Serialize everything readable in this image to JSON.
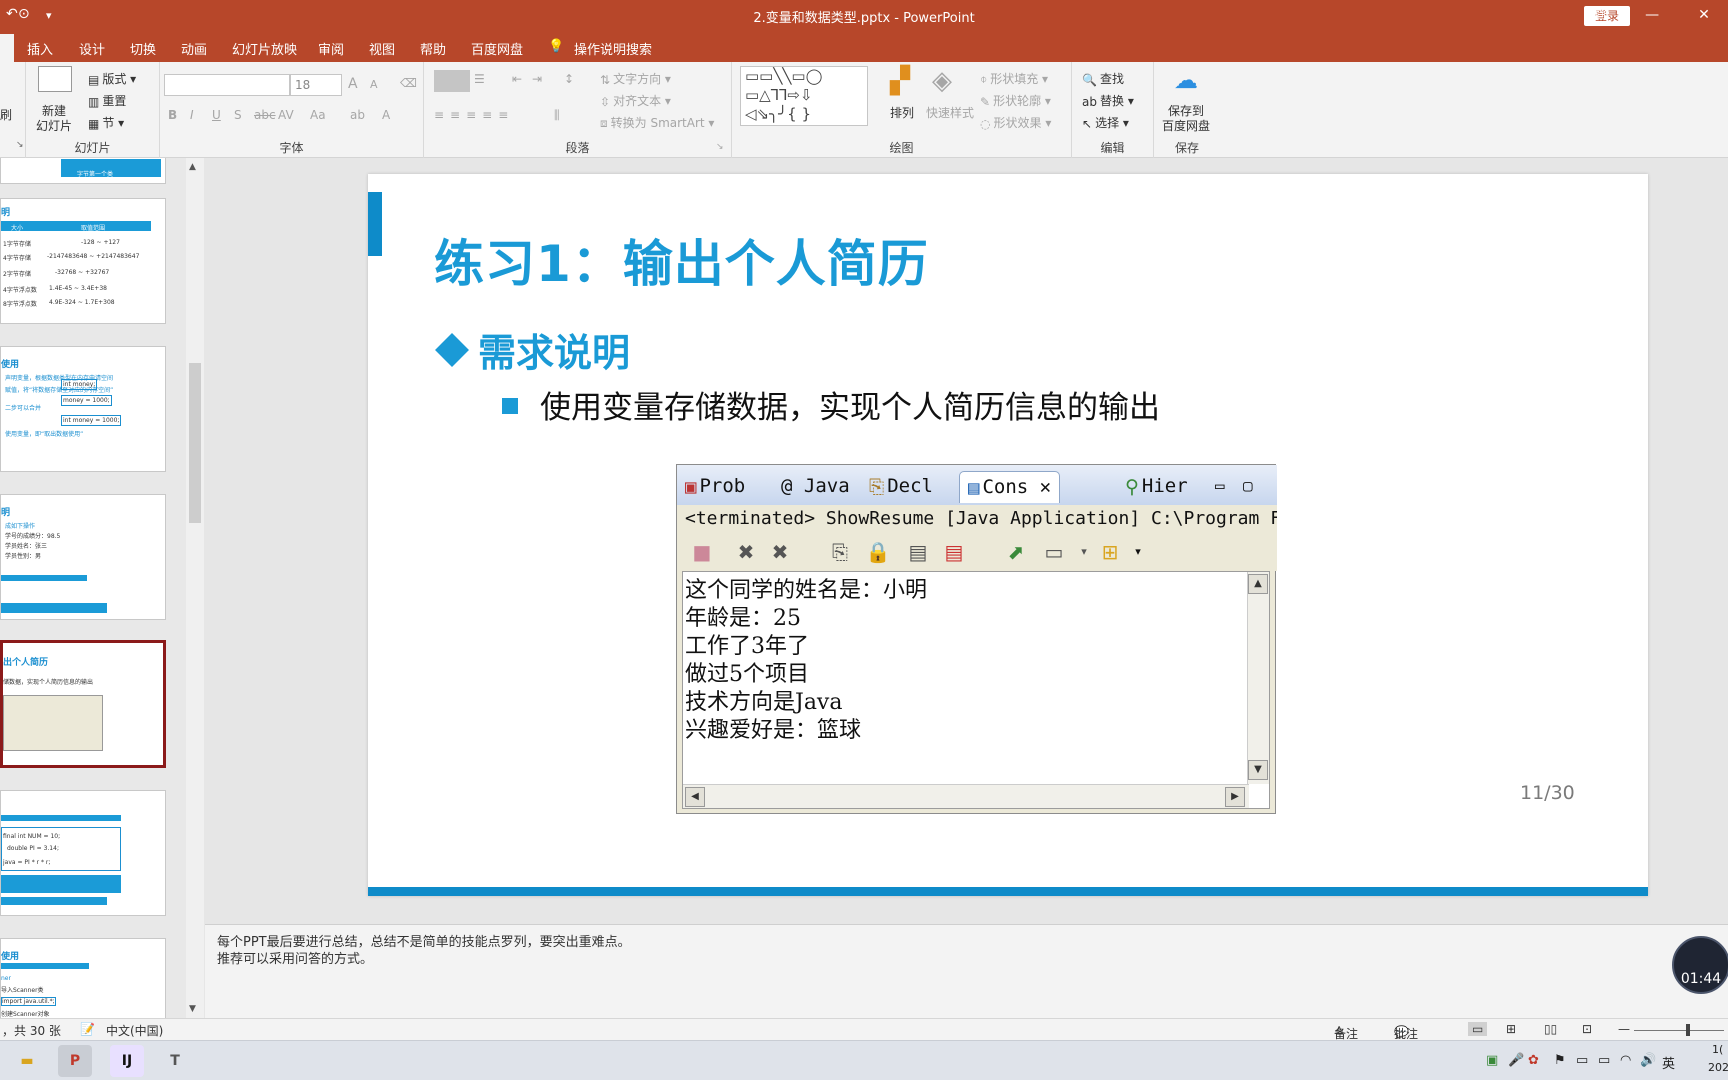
{
  "titlebar": {
    "title": "2.变量和数据类型.pptx  -  PowerPoint",
    "login": "登录",
    "undo_glyph": "↶",
    "present_glyph": "⊙",
    "more_glyph": "▾",
    "min": "—",
    "restore": "⧉",
    "close": "✕"
  },
  "tabs": [
    "插入",
    "设计",
    "切换",
    "动画",
    "幻灯片放映",
    "审阅",
    "视图",
    "帮助",
    "百度网盘",
    "操作说明搜索"
  ],
  "ribbon": {
    "clipboard_tail": "刷",
    "slides": {
      "new_slide": "新建\n幻灯片",
      "layout": "版式",
      "reset": "重置",
      "section": "节",
      "label": "幻灯片"
    },
    "font": {
      "font_name": "",
      "font_size": "18",
      "label": "字体",
      "bold": "B",
      "italic": "I",
      "underline": "U",
      "shadow": "S",
      "strike": "abc",
      "spacing": "AV",
      "case": "Aa",
      "grow": "A",
      "shrink": "A"
    },
    "paragraph": {
      "text_direction": "文字方向",
      "align_text": "对齐文本",
      "smartart": "转换为 SmartArt",
      "label": "段落"
    },
    "drawing": {
      "arrange": "排列",
      "quick_styles": "快速样式",
      "shape_fill": "形状填充",
      "shape_outline": "形状轮廓",
      "shape_effects": "形状效果",
      "label": "绘图"
    },
    "editing": {
      "find": "查找",
      "replace": "替换",
      "select": "选择",
      "label": "编辑"
    },
    "save": {
      "save_to_baidu": "保存到\n百度网盘",
      "label": "保存"
    }
  },
  "thumbnails": [
    {
      "title": "",
      "lines": [
        "字节第一个类"
      ]
    },
    {
      "title": "明",
      "lines": [
        "大小",
        "取值范围",
        "1字节存储",
        "-128 ~ +127",
        "4字节存储",
        "-2147483648 ~ +2147483647",
        "2字节存储",
        "-32768 ~ +32767",
        "4字节浮点数",
        "1.4E-45 ~ 3.4E+38",
        "8字节浮点数",
        "4.9E-324 ~ 1.7E+308"
      ]
    },
    {
      "title": "使用",
      "lines": [
        "声明变量，根据数据类型在内存申请空间",
        "赋值，将“将数据存储至对应的内存空间”",
        "二步可以合并",
        "使用变量，即“取出数据使用”",
        "int money;",
        "money = 1000;",
        "int money = 1000;"
      ]
    },
    {
      "title": "明",
      "lines": [
        "成如下操作",
        "学号的成绩分：98.5",
        "学员姓名：张三",
        "学员性别：男"
      ]
    },
    {
      "title": "出个人简历",
      "lines": [
        "储数据，实现个人简历信息的输出"
      ]
    },
    {
      "title": "",
      "lines": [
        "final int NUM = 10;",
        "double PI = 3.14;",
        "java = PI * r * r;"
      ]
    },
    {
      "title": "使用",
      "lines": [
        "ner",
        "导入Scanner类",
        "import java.util.*;",
        "创建Scanner对象"
      ]
    }
  ],
  "slide": {
    "title": "练习1：输出个人简历",
    "subtitle": "需求说明",
    "bullet": "使用变量存储数据，实现个人简历信息的输出",
    "page": "11/30",
    "eclipse": {
      "tabs": [
        "Prob",
        "@ Java",
        "Decl",
        "Cons",
        "Hier"
      ],
      "status": "<terminated> ShowResume [Java Application] C:\\Program Fil",
      "output": [
        "这个同学的姓名是：小明",
        "年龄是：25",
        "工作了3年了",
        "做过5个项目",
        "技术方向是Java",
        "兴趣爱好是：篮球"
      ]
    }
  },
  "notes": [
    "每个PPT最后要进行总结，总结不是简单的技能点罗列，要突出重难点。",
    "推荐可以采用问答的方式。"
  ],
  "statusbar": {
    "slide_count": "，共 30 张",
    "language": "中文(中国)",
    "notes": "备注",
    "comments": "批注",
    "zoom_minus": "—",
    "zoom_plus": "+"
  },
  "timer": "01:44",
  "taskbar": {
    "apps": [
      "PowerPoint",
      "IntelliJ IDEA",
      "Typora"
    ],
    "tray_lang": "英",
    "clock_a": "1(",
    "clock_b": "202"
  }
}
